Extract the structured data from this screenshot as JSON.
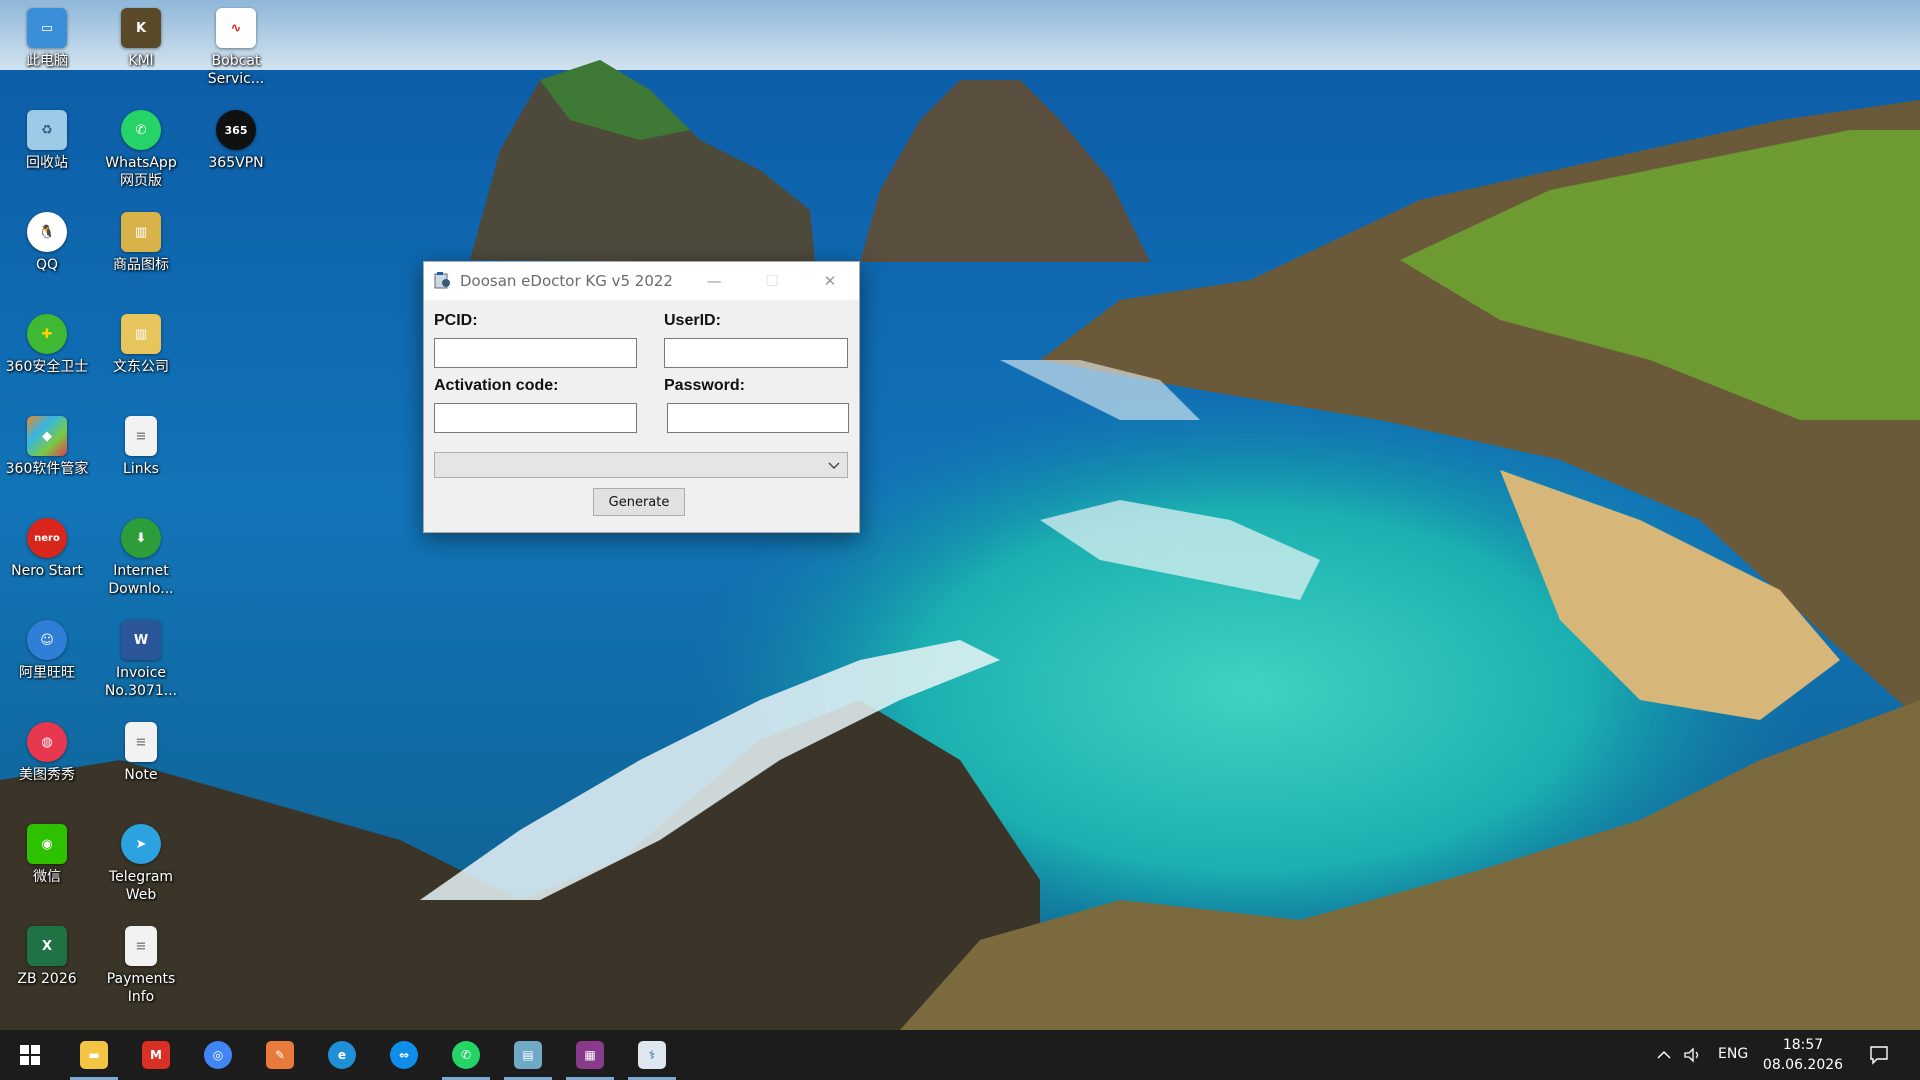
{
  "desktop": {
    "icons": [
      {
        "label": "此电脑",
        "icon": "computer-icon",
        "color": "#3a8fd8"
      },
      {
        "label": "KMl",
        "icon": "kml-icon",
        "color": "#5a4a2a"
      },
      {
        "label": "Bobcat\nServic...",
        "icon": "bobcat-icon",
        "color": "#ffffff"
      },
      {
        "label": "回收站",
        "icon": "recycle-bin-icon",
        "color": "#9ccbe8"
      },
      {
        "label": "WhatsApp\n网页版",
        "icon": "whatsapp-icon",
        "color": "#25d366"
      },
      {
        "label": "365VPN",
        "icon": "vpn-icon",
        "color": "#111111"
      },
      {
        "label": "QQ",
        "icon": "qq-icon",
        "color": "#ffffff"
      },
      {
        "label": "商品图标",
        "icon": "folder-zip-icon",
        "color": "#d8b34a"
      },
      {
        "label": "360安全卫士",
        "icon": "shield-icon",
        "color": "#3fb834"
      },
      {
        "label": "文东公司",
        "icon": "folder-zip-icon",
        "color": "#e8c45c"
      },
      {
        "label": "360软件管家",
        "icon": "app-manager-icon",
        "color": "#f08a24"
      },
      {
        "label": "Links",
        "icon": "document-icon",
        "color": "#f2f2f2"
      },
      {
        "label": "Nero Start",
        "icon": "nero-icon",
        "color": "#d9261c"
      },
      {
        "label": "Internet\nDownlo...",
        "icon": "globe-download-icon",
        "color": "#2d9d3a"
      },
      {
        "label": "阿里旺旺",
        "icon": "chat-bubble-icon",
        "color": "#2f7fd8"
      },
      {
        "label": "Invoice\nNo.3071...",
        "icon": "word-document-icon",
        "color": "#2b579a"
      },
      {
        "label": "美图秀秀",
        "icon": "meitu-icon",
        "color": "#e8384f"
      },
      {
        "label": "Note",
        "icon": "document-icon",
        "color": "#f2f2f2"
      },
      {
        "label": "微信",
        "icon": "wechat-icon",
        "color": "#2dc100"
      },
      {
        "label": "Telegram\nWeb",
        "icon": "telegram-icon",
        "color": "#2aa3e0"
      },
      {
        "label": "ZB 2026",
        "icon": "excel-icon",
        "color": "#1f7244"
      },
      {
        "label": "Payments\nInfo",
        "icon": "document-icon",
        "color": "#f2f2f2"
      }
    ]
  },
  "window": {
    "title": "Doosan eDoctor KG v5 2022",
    "minimize": "—",
    "maximize": "☐",
    "close": "✕",
    "pcid_label": "PCID:",
    "userid_label": "UserID:",
    "activation_label": "Activation code:",
    "password_label": "Password:",
    "pcid_value": "",
    "userid_value": "",
    "activation_value": "",
    "password_value": "",
    "combo_value": "",
    "generate_label": "Generate"
  },
  "taskbar": {
    "items": [
      {
        "icon": "file-explorer-icon",
        "color": "#f4c542",
        "running": true
      },
      {
        "icon": "gmail-icon",
        "color": "#d93025",
        "running": false
      },
      {
        "icon": "chrome-icon",
        "color": "#4285f4",
        "running": false
      },
      {
        "icon": "paint-icon",
        "color": "#e87a3c",
        "running": false
      },
      {
        "icon": "edge-icon",
        "color": "#1f8fd6",
        "running": false
      },
      {
        "icon": "teamviewer-icon",
        "color": "#0e8ee9",
        "running": false
      },
      {
        "icon": "whatsapp-icon",
        "color": "#25d366",
        "running": true
      },
      {
        "icon": "notepad-icon",
        "color": "#6fa9c6",
        "running": true
      },
      {
        "icon": "winrar-icon",
        "color": "#8a3a8a",
        "running": true
      },
      {
        "icon": "edoctor-icon",
        "color": "#dfe8f0",
        "running": true
      }
    ],
    "lang": "ENG",
    "time": "18:57",
    "date": "08.06.2026"
  }
}
